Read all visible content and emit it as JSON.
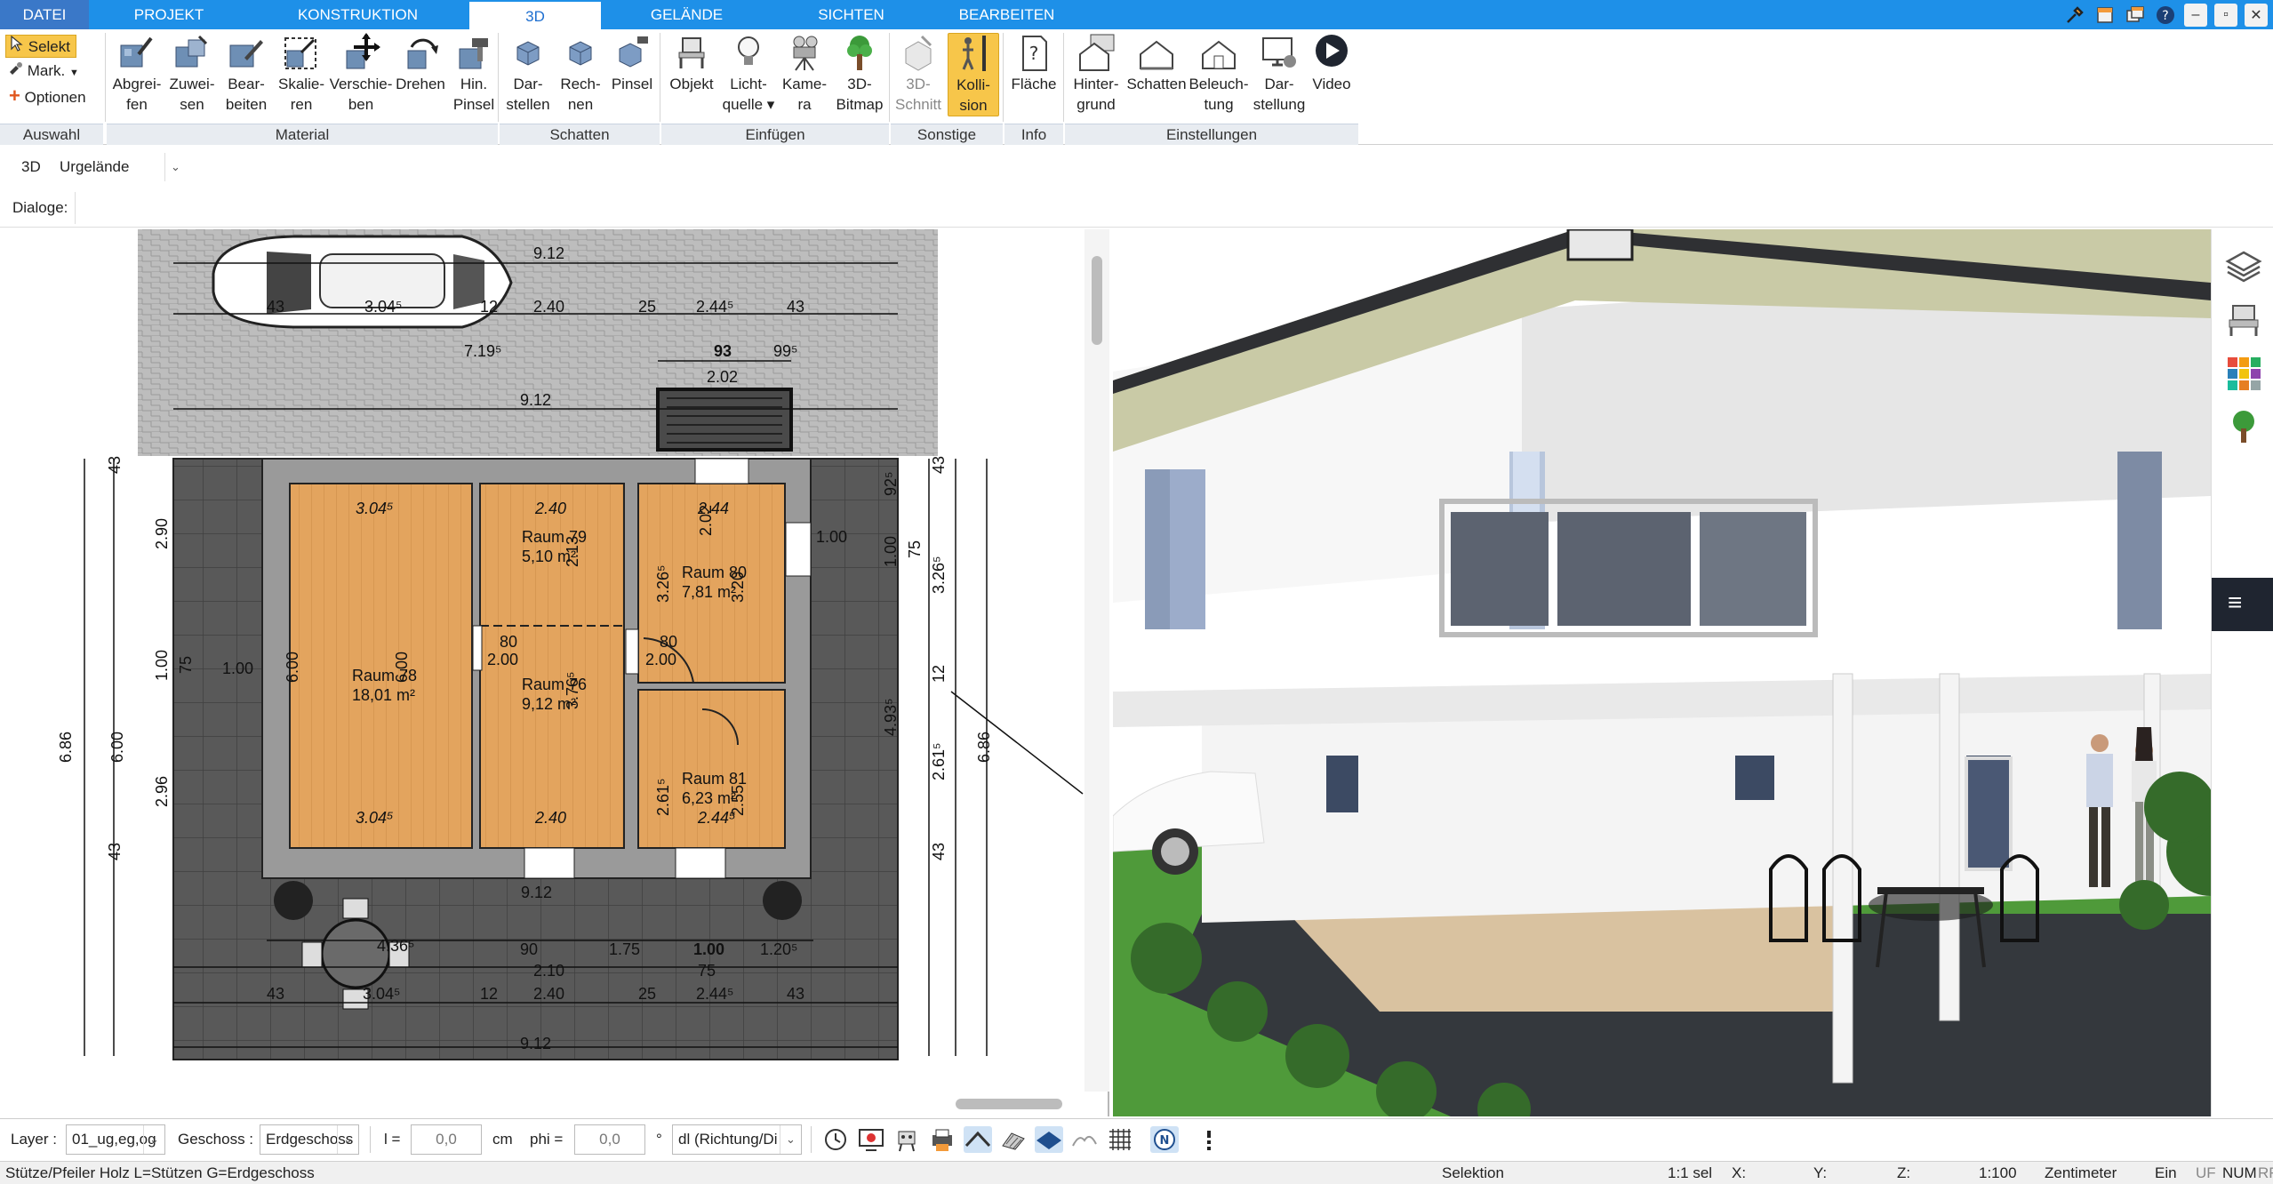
{
  "menu": {
    "tabs": [
      "DATEI",
      "PROJEKT",
      "KONSTRUKTION",
      "3D",
      "GELÄNDE",
      "SICHTEN",
      "BEARBEITEN"
    ],
    "active": "3D"
  },
  "ribbon": {
    "selection": {
      "selekt": "Selekt",
      "mark": "Mark.",
      "optionen": "Optionen"
    },
    "groups": {
      "auswahl": "Auswahl",
      "material": "Material",
      "schatten": "Schatten",
      "einfuegen": "Einfügen",
      "sonstige": "Sonstige",
      "info": "Info",
      "einstellungen": "Einstellungen"
    },
    "buttons": {
      "abgreifen": [
        "Abgrei-",
        "fen"
      ],
      "zuweisen": [
        "Zuwei-",
        "sen"
      ],
      "bearbeiten": [
        "Bear-",
        "beiten"
      ],
      "skalieren": [
        "Skalie-",
        "ren"
      ],
      "verschieben": [
        "Verschie-",
        "ben"
      ],
      "drehen": [
        "Drehen",
        ""
      ],
      "hinpinsel": [
        "Hin.",
        "Pinsel"
      ],
      "darstellen": [
        "Dar-",
        "stellen"
      ],
      "rechnen": [
        "Rech-",
        "nen"
      ],
      "pinsel": [
        "Pinsel",
        ""
      ],
      "objekt": [
        "Objekt",
        ""
      ],
      "lichtquelle": [
        "Licht-",
        "quelle ▾"
      ],
      "kamera": [
        "Kame-",
        "ra"
      ],
      "bitmap3d": [
        "3D-",
        "Bitmap"
      ],
      "schnitt3d": [
        "3D-",
        "Schnitt"
      ],
      "kollision": [
        "Kolli-",
        "sion"
      ],
      "flaeche": [
        "Fläche",
        ""
      ],
      "hintergrund": [
        "Hinter-",
        "grund"
      ],
      "schatten": [
        "Schatten",
        ""
      ],
      "beleuchtung": [
        "Beleuch-",
        "tung"
      ],
      "darstellung": [
        "Dar-",
        "stellung"
      ],
      "video": [
        "Video",
        ""
      ]
    }
  },
  "toolbar2": {
    "mode": "3D",
    "terrain": "Urgelände"
  },
  "toolbar3": {
    "dialoge": "Dialoge:"
  },
  "plan": {
    "dims": {
      "top1": "9.12",
      "car_w": "3.04⁵",
      "d43a": "43",
      "d12a": "12",
      "d240a": "2.40",
      "d25a": "25",
      "d2445a": "2.44⁵",
      "d43b": "43",
      "d7195": "7.19⁵",
      "d93": "93",
      "d995": "99⁵",
      "d202": "2.02",
      "top2": "9.12",
      "left686": "6.86",
      "left600": "6.00",
      "left290": "2.90",
      "left296": "2.96",
      "left100": "1.00",
      "left75": "75",
      "left43t": "43",
      "left43b": "43",
      "r686": "6.86",
      "r326": "3.26⁵",
      "r4935": "4.93⁵",
      "r2615": "2.61⁵",
      "r100": "1.00",
      "r75": "75",
      "r43t": "43",
      "r43b": "43",
      "r925": "92⁵",
      "r12": "12",
      "bot1": "9.12",
      "bot_d90": "90",
      "bot_210": "2.10",
      "bot_175": "1.75",
      "bot_100": "1.00",
      "bot_75": "75",
      "bot_1205": "1.20⁵",
      "bot_43a": "43",
      "bot_3045": "3.04⁵",
      "bot_12": "12",
      "bot_240": "2.40",
      "bot_25": "25",
      "bot_2445": "2.44⁵",
      "bot_43b": "43",
      "bot_4365": "4.36⁵"
    },
    "rooms": [
      {
        "name": "Raum 78",
        "area": "18,01 m²",
        "w_top": "3.04⁵",
        "w_bot": "3.04⁵",
        "h_l": "6.00",
        "h_r": "6.00"
      },
      {
        "name": "Raum 79",
        "area": "5,10 m²",
        "w_top": "2.40",
        "h": "2.13"
      },
      {
        "name": "Raum 76",
        "area": "9,12 m²",
        "w_bot": "2.40",
        "h": "3.76⁵"
      },
      {
        "name": "Raum 80",
        "area": "7,81 m²",
        "w_top": "2.44",
        "h_l": "3.26⁵",
        "h_r": "3.20"
      },
      {
        "name": "Raum 81",
        "area": "6,23 m²",
        "w_bot": "2.44⁵",
        "h_l": "2.61⁵",
        "h_r": "2.55"
      }
    ],
    "doors": {
      "d1": "80",
      "d1h": "2.00",
      "d2": "80",
      "d2h": "2.00",
      "d3": "92",
      "d3h": "2.02"
    }
  },
  "bottombar": {
    "layer_label": "Layer :",
    "layer_value": "01_ug,eg,og",
    "geschoss_label": "Geschoss :",
    "geschoss_value": "Erdgeschoss",
    "l_label": "l =",
    "l_value": "0,0",
    "l_unit": "cm",
    "phi_label": "phi =",
    "phi_value": "0,0",
    "phi_unit": "°",
    "direction": "dl (Richtung/Di"
  },
  "statusbar": {
    "hint": "Stütze/Pfeiler Holz L=Stützen G=Erdgeschoss",
    "mode": "Selektion",
    "sel": "1:1 sel",
    "x": "X:",
    "y": "Y:",
    "z": "Z:",
    "scale": "1:100",
    "unit": "Zentimeter",
    "ein": "Ein",
    "uf": "UF",
    "num": "NUM",
    "rf": "RF"
  },
  "colors": {
    "accent": "#1e90e8",
    "highlight": "#f7c64a",
    "floor": "#e0a25e",
    "paving": "#585858",
    "drive": "#bdbdbd"
  }
}
